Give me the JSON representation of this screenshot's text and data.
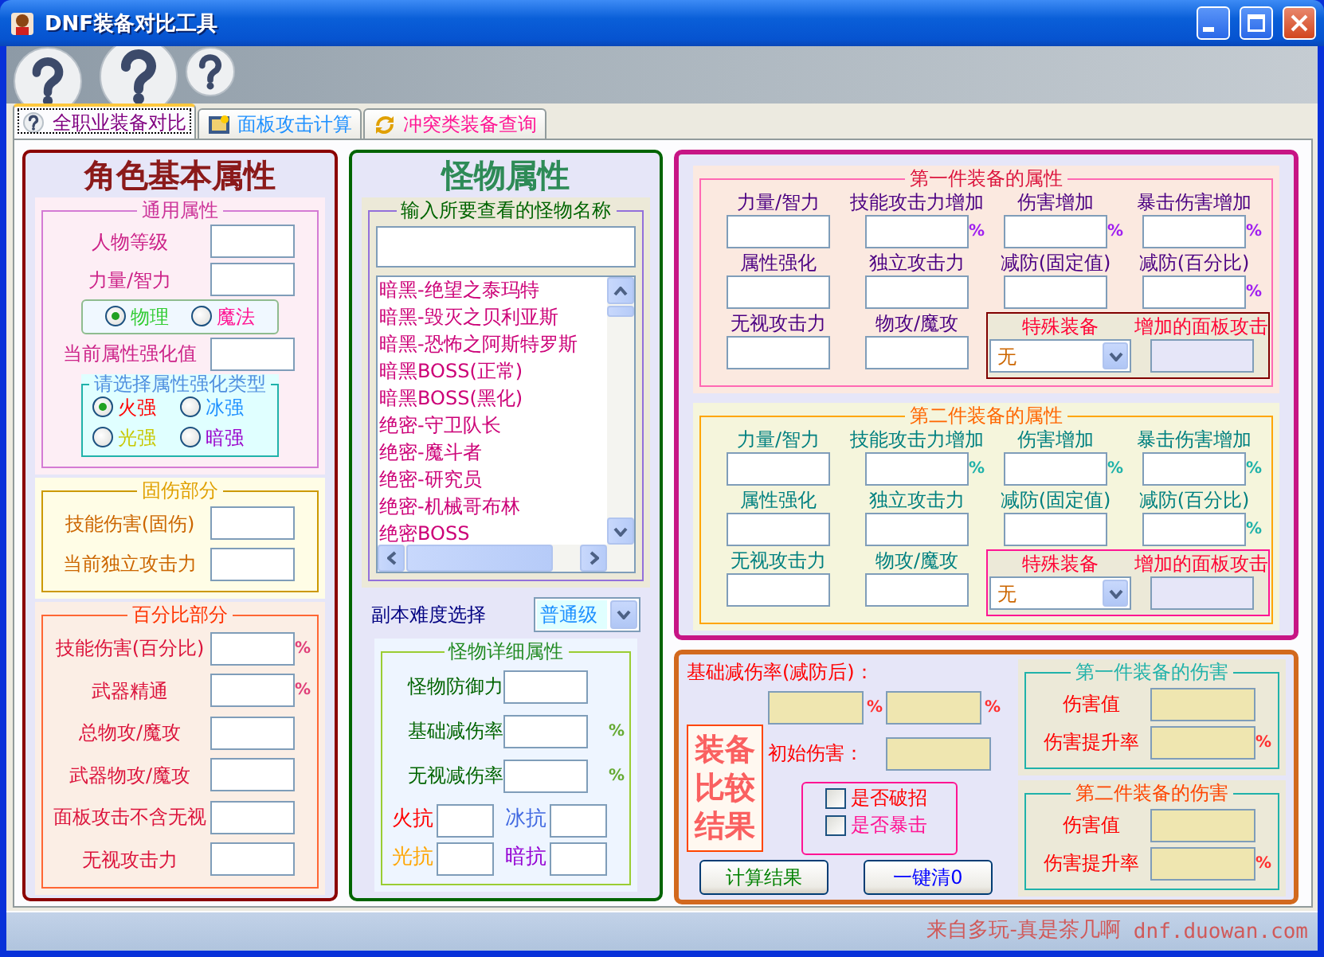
{
  "window": {
    "title": "DNF装备对比工具"
  },
  "tabs": [
    {
      "label": "全职业装备对比",
      "selected": true,
      "color": "#800080"
    },
    {
      "label": "面板攻击计算",
      "selected": false,
      "color": "#1e90ff"
    },
    {
      "label": "冲突类装备查询",
      "selected": false,
      "color": "#ff1493"
    }
  ],
  "character": {
    "title": "角色基本属性",
    "general": {
      "legend": "通用属性",
      "fields": [
        {
          "label": "人物等级"
        },
        {
          "label": "力量/智力"
        }
      ],
      "attack_type": [
        {
          "label": "物理",
          "selected": true,
          "color": "#33cc33"
        },
        {
          "label": "魔法",
          "selected": false,
          "color": "#ff1493"
        }
      ],
      "enhance_field": {
        "label": "当前属性强化值"
      },
      "enhance_type": {
        "legend": "请选择属性强化类型",
        "options": [
          {
            "label": "火强",
            "selected": true,
            "color": "#ff0000"
          },
          {
            "label": "冰强",
            "selected": false,
            "color": "#1e90ff"
          },
          {
            "label": "光强",
            "selected": false,
            "color": "#c8c800"
          },
          {
            "label": "暗强",
            "selected": false,
            "color": "#9900cc"
          }
        ]
      }
    },
    "fixed": {
      "legend": "固伤部分",
      "fields": [
        {
          "label": "技能伤害(固伤)"
        },
        {
          "label": "当前独立攻击力"
        }
      ]
    },
    "percent": {
      "legend": "百分比部分",
      "fields": [
        {
          "label": "技能伤害(百分比)",
          "unit": "%"
        },
        {
          "label": "武器精通",
          "unit": "%"
        },
        {
          "label": "总物攻/魔攻"
        },
        {
          "label": "武器物攻/魔攻"
        },
        {
          "label": "面板攻击不含无视"
        },
        {
          "label": "无视攻击力"
        }
      ]
    }
  },
  "monster": {
    "title": "怪物属性",
    "search": {
      "legend": "输入所要查看的怪物名称",
      "items": [
        "暗黑-绝望之泰玛特",
        "暗黑-毁灭之贝利亚斯",
        "暗黑-恐怖之阿斯特罗斯",
        "暗黑BOSS(正常)",
        "暗黑BOSS(黑化)",
        "绝密-守卫队长",
        "绝密-魔斗者",
        "绝密-研究员",
        "绝密-机械哥布林",
        "绝密BOSS"
      ]
    },
    "difficulty": {
      "label": "副本难度选择",
      "value": "普通级"
    },
    "details": {
      "legend": "怪物详细属性",
      "fields": [
        {
          "label": "怪物防御力"
        },
        {
          "label": "基础减伤率",
          "unit": "%"
        },
        {
          "label": "无视减伤率",
          "unit": "%"
        }
      ],
      "resists": [
        {
          "label": "火抗",
          "color": "#ff0000"
        },
        {
          "label": "冰抗",
          "color": "#4169e1"
        },
        {
          "label": "光抗",
          "color": "#ffa500"
        },
        {
          "label": "暗抗",
          "color": "#9400d3"
        }
      ]
    }
  },
  "equipment": [
    {
      "legend": "第一件装备的属性",
      "fields": [
        {
          "label": "力量/智力"
        },
        {
          "label": "技能攻击力增加",
          "unit": "%"
        },
        {
          "label": "伤害增加",
          "unit": "%"
        },
        {
          "label": "暴击伤害增加",
          "unit": "%"
        },
        {
          "label": "属性强化"
        },
        {
          "label": "独立攻击力"
        },
        {
          "label": "减防(固定值)"
        },
        {
          "label": "减防(百分比)",
          "unit": "%"
        },
        {
          "label": "无视攻击力"
        },
        {
          "label": "物攻/魔攻"
        }
      ],
      "special": {
        "label": "特殊装备",
        "value": "无",
        "bonus_label": "增加的面板攻击"
      }
    },
    {
      "legend": "第二件装备的属性",
      "fields": [
        {
          "label": "力量/智力"
        },
        {
          "label": "技能攻击力增加",
          "unit": "%"
        },
        {
          "label": "伤害增加",
          "unit": "%"
        },
        {
          "label": "暴击伤害增加",
          "unit": "%"
        },
        {
          "label": "属性强化"
        },
        {
          "label": "独立攻击力"
        },
        {
          "label": "减防(固定值)"
        },
        {
          "label": "减防(百分比)",
          "unit": "%"
        },
        {
          "label": "无视攻击力"
        },
        {
          "label": "物攻/魔攻"
        }
      ],
      "special": {
        "label": "特殊装备",
        "value": "无",
        "bonus_label": "增加的面板攻击"
      }
    }
  ],
  "result": {
    "title": "装备比较结果",
    "reduction_label": "基础减伤率(减防后)：",
    "reduction_units": [
      "%",
      "%"
    ],
    "initial_damage_label": "初始伤害：",
    "options": [
      {
        "label": "是否破招",
        "checked": false
      },
      {
        "label": "是否暴击",
        "checked": false
      }
    ],
    "buttons": [
      "计算结果",
      "一键清0"
    ],
    "damage": [
      {
        "legend": "第一件装备的伤害",
        "fields": [
          {
            "label": "伤害值"
          },
          {
            "label": "伤害提升率",
            "unit": "%"
          }
        ]
      },
      {
        "legend": "第二件装备的伤害",
        "fields": [
          {
            "label": "伤害值"
          },
          {
            "label": "伤害提升率",
            "unit": "%"
          }
        ]
      }
    ]
  },
  "status_bar": {
    "text": "来自多玩-真是茶几啊",
    "link": "dnf.duowan.com"
  }
}
